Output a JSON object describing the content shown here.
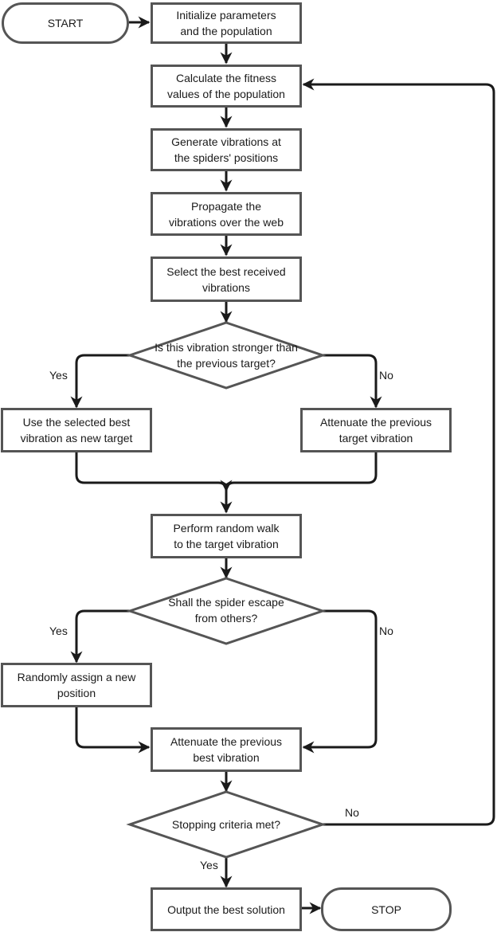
{
  "flowchart": {
    "start": "START",
    "stop": "STOP",
    "steps": {
      "init": "Initialize parameters\nand the population",
      "fitness": "Calculate the fitness\nvalues of the population",
      "generate": "Generate vibrations at\nthe spiders' positions",
      "propagate": "Propagate the\nvibrations over the web",
      "select": "Select the best received\nvibrations",
      "use_best": "Use the selected best\nvibration as new target",
      "attenuate_target": "Attenuate the previous\ntarget vibration",
      "random_walk": "Perform random walk\nto the target vibration",
      "random_assign": "Randomly assign a new\nposition",
      "attenuate_best": "Attenuate the previous\nbest vibration",
      "output": "Output the best solution"
    },
    "decisions": {
      "stronger": "Is this vibration stronger than\nthe previous target?",
      "escape": "Shall the spider escape\nfrom others?",
      "stopping": "Stopping criteria met?"
    },
    "labels": {
      "yes": "Yes",
      "no": "No"
    }
  }
}
